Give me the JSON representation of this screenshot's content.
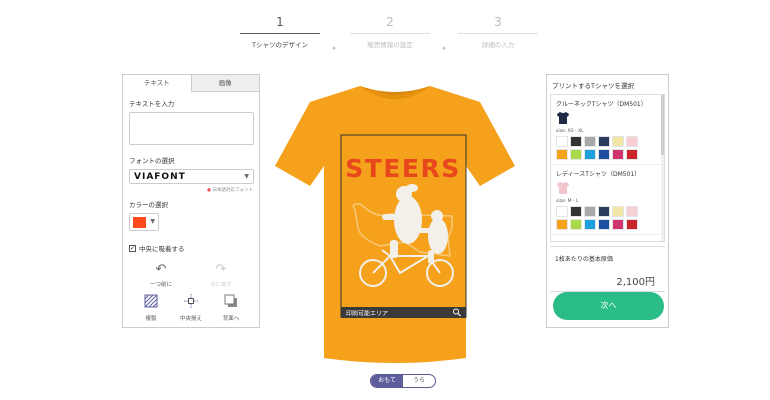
{
  "steps": [
    {
      "num": "1",
      "label": "Tシャツのデザイン"
    },
    {
      "num": "2",
      "label": "販売情報の設定"
    },
    {
      "num": "3",
      "label": "詳細の入力"
    }
  ],
  "left_panel": {
    "tabs": [
      "テキスト",
      "画像"
    ],
    "text_input_label": "テキストを入力",
    "font_label": "フォントの選択",
    "font_value": "VIAFONT",
    "font_note": "日本語対応フォント",
    "color_label": "カラーの選択",
    "color_value": "#ff4a1c",
    "center_snap_label": "中央に吸着する",
    "undo_label": "一つ前に",
    "redo_label": "元に戻す",
    "tools": [
      "複製",
      "中央揃え",
      "背面へ"
    ]
  },
  "design": {
    "headline": "STEERS",
    "print_area_label": "印刷可能エリア",
    "shirt_color": "#f5a11b"
  },
  "view_toggle": {
    "front": "おもて",
    "back": "うら"
  },
  "right_panel": {
    "title": "プリントするTシャツを選択",
    "products": [
      {
        "name": "クルーネックTシャツ（DM501）",
        "size": "size: XS - XL",
        "icon_color": "#1e2a44",
        "colors": [
          "#ffffff",
          "#333333",
          "#a9a9a9",
          "#2a3a5c",
          "#f2e6a6",
          "#f5cfd2",
          "#f5a11b",
          "#a8d94a",
          "#1ea0e0",
          "#1c4fa0",
          "#d0346f",
          "#c8242b"
        ]
      },
      {
        "name": "レディースTシャツ（DM501）",
        "size": "size: M - L",
        "icon_color": "#f2c6cc",
        "colors": [
          "#ffffff",
          "#333333",
          "#a9a9a9",
          "#2a3a5c",
          "#f2e6a6",
          "#f5cfd2",
          "#f5a11b",
          "#a8d94a",
          "#1ea0e0",
          "#1c4fa0",
          "#d0346f",
          "#c8242b"
        ]
      }
    ],
    "price_label": "1枚あたりの基本原価",
    "price": "2,100円",
    "next_button": "次へ"
  }
}
